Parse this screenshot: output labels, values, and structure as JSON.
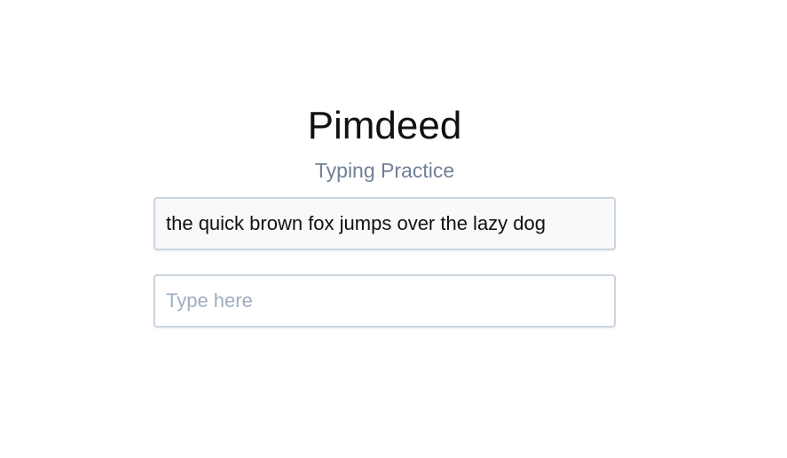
{
  "app": {
    "title": "Pimdeed",
    "subtitle": "Typing Practice"
  },
  "practice": {
    "target_text": "the quick brown fox jumps over the lazy dog",
    "input_value": "",
    "input_placeholder": "Type here"
  },
  "colors": {
    "subtitle": "#718096",
    "border": "#cbd5e0",
    "target_background": "#f8f9fa",
    "placeholder": "#a0aec0"
  }
}
